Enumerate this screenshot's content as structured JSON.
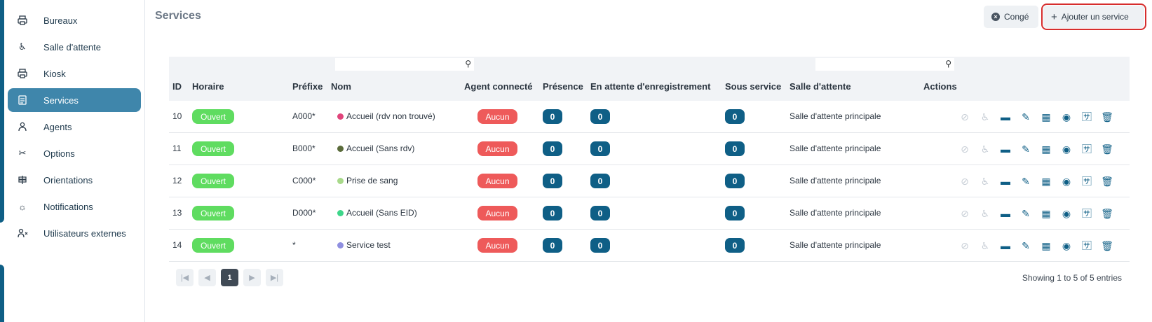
{
  "sidebar": {
    "items": [
      {
        "label": "Bureaux",
        "icon": "printer-icon",
        "active": false
      },
      {
        "label": "Salle d'attente",
        "icon": "wheelchair-icon",
        "active": false
      },
      {
        "label": "Kiosk",
        "icon": "printer-icon",
        "active": false
      },
      {
        "label": "Services",
        "icon": "list-icon",
        "active": true
      },
      {
        "label": "Agents",
        "icon": "agent-icon",
        "active": false
      },
      {
        "label": "Options",
        "icon": "tools-icon",
        "active": false
      },
      {
        "label": "Orientations",
        "icon": "signpost-icon",
        "active": false
      },
      {
        "label": "Notifications",
        "icon": "bell-icon",
        "active": false
      },
      {
        "label": "Utilisateurs externes",
        "icon": "user-x-icon",
        "active": false
      }
    ]
  },
  "header": {
    "title": "Services",
    "conge_label": "Congé",
    "add_label": "Ajouter un service"
  },
  "table": {
    "columns": [
      "ID",
      "Horaire",
      "Préfixe",
      "Nom",
      "Agent connecté",
      "Présence",
      "En attente d'enregistrement",
      "Sous service",
      "Salle d'attente",
      "Actions"
    ],
    "rows": [
      {
        "id": "10",
        "horaire": "Ouvert",
        "prefixe": "A000*",
        "nom": "Accueil (rdv non trouvé)",
        "dot": "#e0457b",
        "agent": "Aucun",
        "presence": "0",
        "attente": "0",
        "sous": "0",
        "salle": "Salle d'attente principale"
      },
      {
        "id": "11",
        "horaire": "Ouvert",
        "prefixe": "B000*",
        "nom": "Accueil (Sans rdv)",
        "dot": "#5a6b3a",
        "agent": "Aucun",
        "presence": "0",
        "attente": "0",
        "sous": "0",
        "salle": "Salle d'attente principale"
      },
      {
        "id": "12",
        "horaire": "Ouvert",
        "prefixe": "C000*",
        "nom": "Prise de sang",
        "dot": "#a8d98a",
        "agent": "Aucun",
        "presence": "0",
        "attente": "0",
        "sous": "0",
        "salle": "Salle d'attente principale"
      },
      {
        "id": "13",
        "horaire": "Ouvert",
        "prefixe": "D000*",
        "nom": "Accueil (Sans EID)",
        "dot": "#3ed68a",
        "agent": "Aucun",
        "presence": "0",
        "attente": "0",
        "sous": "0",
        "salle": "Salle d'attente principale"
      },
      {
        "id": "14",
        "horaire": "Ouvert",
        "prefixe": "*",
        "nom": "Service test",
        "dot": "#8f8fe0",
        "agent": "Aucun",
        "presence": "0",
        "attente": "0",
        "sous": "0",
        "salle": "Salle d'attente principale"
      }
    ]
  },
  "pagination": {
    "current_page": "1",
    "info": "Showing 1 to 5 of 5 entries"
  },
  "colors": {
    "accent": "#0f5f86",
    "active_nav": "#3f86ab",
    "open_badge": "#5fdc60",
    "none_badge": "#ee5a5a",
    "highlight_outline": "#d62d2d"
  }
}
